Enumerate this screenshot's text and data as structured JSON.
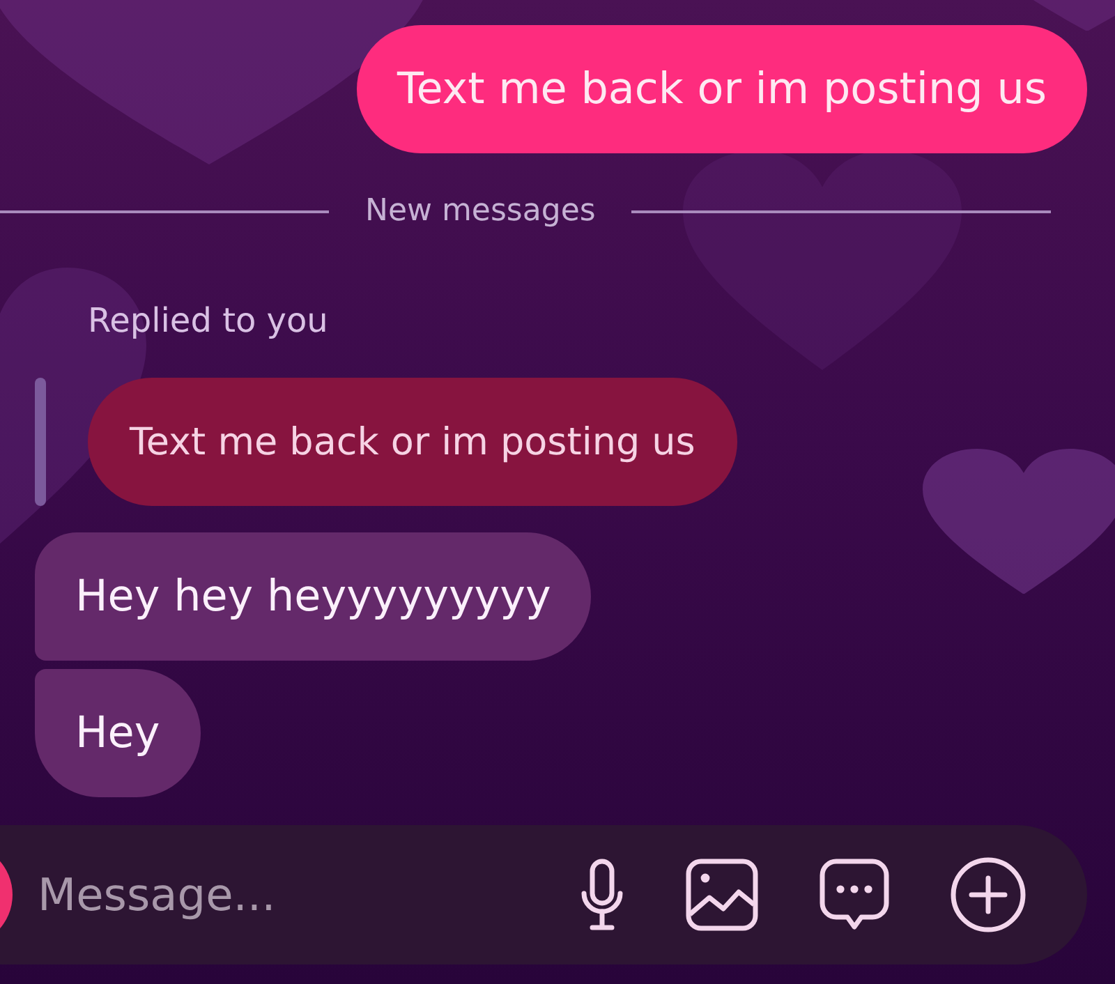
{
  "messages": [
    {
      "kind": "outgoing",
      "text": "Text me back or im posting us"
    },
    {
      "kind": "divider",
      "text": "New messages"
    },
    {
      "kind": "reply",
      "label": "Replied to you",
      "quoted": "Text me back or im posting us"
    },
    {
      "kind": "incoming",
      "text": "Hey hey heyyyyyyyyy"
    },
    {
      "kind": "incoming",
      "text": "Hey"
    }
  ],
  "composer": {
    "placeholder": "Message..."
  }
}
